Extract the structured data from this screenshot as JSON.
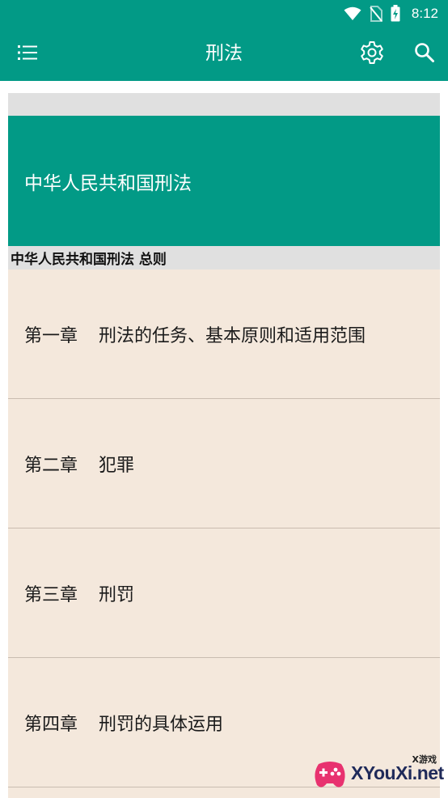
{
  "status_bar": {
    "time": "8:12",
    "icons": [
      "wifi-icon",
      "no-sim-icon",
      "battery-charging-icon"
    ]
  },
  "app_bar": {
    "title": "刑法",
    "menu_icon": "menu-list-icon",
    "settings_icon": "gear-icon",
    "search_icon": "search-icon"
  },
  "banner": {
    "title": "中华人民共和国刑法"
  },
  "section": {
    "header": "中华人民共和国刑法 总则"
  },
  "chapters": [
    {
      "num": "第一章",
      "title": "刑法的任务、基本原则和适用范围"
    },
    {
      "num": "第二章",
      "title": "犯罪"
    },
    {
      "num": "第三章",
      "title": "刑罚"
    },
    {
      "num": "第四章",
      "title": "刑罚的具体运用"
    }
  ],
  "watermark": {
    "text": "XYouXi.net",
    "small": "X游戏"
  },
  "colors": {
    "primary": "#029a86",
    "list_bg": "#f4e8dc",
    "divider": "#c9bcb0",
    "header_gray": "#e0e0e0"
  }
}
